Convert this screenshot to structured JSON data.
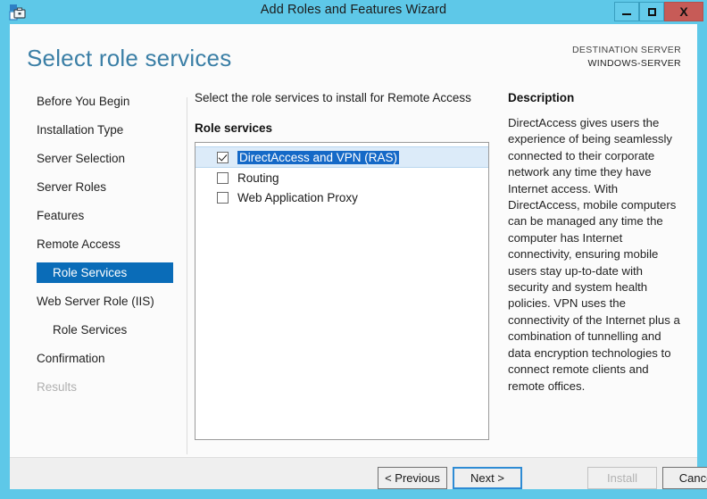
{
  "window": {
    "title": "Add Roles and Features Wizard",
    "icon": "server-wizard-icon",
    "minimize_label": "–",
    "maximize_label": "□",
    "close_label": "X"
  },
  "header": {
    "page_title": "Select role services",
    "destination_label": "DESTINATION SERVER",
    "destination_value": "WINDOWS-SERVER"
  },
  "sidebar": {
    "items": [
      {
        "label": "Before You Begin",
        "level": 0,
        "state": "normal"
      },
      {
        "label": "Installation Type",
        "level": 0,
        "state": "normal"
      },
      {
        "label": "Server Selection",
        "level": 0,
        "state": "normal"
      },
      {
        "label": "Server Roles",
        "level": 0,
        "state": "normal"
      },
      {
        "label": "Features",
        "level": 0,
        "state": "normal"
      },
      {
        "label": "Remote Access",
        "level": 0,
        "state": "normal"
      },
      {
        "label": "Role Services",
        "level": 1,
        "state": "selected"
      },
      {
        "label": "Web Server Role (IIS)",
        "level": 0,
        "state": "normal"
      },
      {
        "label": "Role Services",
        "level": 1,
        "state": "normal"
      },
      {
        "label": "Confirmation",
        "level": 0,
        "state": "normal"
      },
      {
        "label": "Results",
        "level": 0,
        "state": "disabled"
      }
    ]
  },
  "main": {
    "instruction": "Select the role services to install for Remote Access",
    "roleservices_label": "Role services",
    "role_services": [
      {
        "label": "DirectAccess and VPN (RAS)",
        "checked": true,
        "selected": true
      },
      {
        "label": "Routing",
        "checked": false,
        "selected": false
      },
      {
        "label": "Web Application Proxy",
        "checked": false,
        "selected": false
      }
    ]
  },
  "description": {
    "title": "Description",
    "body": "DirectAccess gives users the experience of being seamlessly connected to their corporate network any time they have Internet access. With DirectAccess, mobile computers can be managed any time the computer has Internet connectivity, ensuring mobile users stay up-to-date with security and system health policies. VPN uses the connectivity of the Internet plus a combination of tunnelling and data encryption technologies to connect remote clients and remote offices."
  },
  "footer": {
    "previous_label": "< Previous",
    "next_label": "Next >",
    "install_label": "Install",
    "cancel_label": "Cancel",
    "install_enabled": false
  },
  "colors": {
    "window_chrome": "#5ec8e8",
    "close_button": "#c75b57",
    "accent_title": "#3b7fa6",
    "nav_selected": "#0a6cb8",
    "row_selected_band": "#dcebf9",
    "text_selected": "#1569c7",
    "footer_bg": "#efefef"
  }
}
